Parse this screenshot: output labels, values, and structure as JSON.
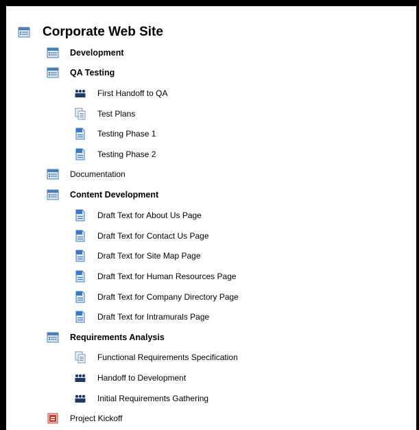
{
  "tree": {
    "root": {
      "label": "Corporate Web Site",
      "icon": "summary-task-icon"
    },
    "items": [
      {
        "label": "Development",
        "icon": "summary-task-icon",
        "bold": true
      },
      {
        "label": "QA Testing",
        "icon": "summary-task-icon",
        "bold": true
      },
      {
        "label": "First Handoff to QA",
        "icon": "team-milestone-icon"
      },
      {
        "label": "Test Plans",
        "icon": "document-copy-icon"
      },
      {
        "label": "Testing Phase 1",
        "icon": "task-icon"
      },
      {
        "label": "Testing Phase 2",
        "icon": "task-icon"
      },
      {
        "label": "Documentation",
        "icon": "summary-task-icon",
        "bold": false
      },
      {
        "label": "Content Development",
        "icon": "summary-task-icon",
        "bold": true
      },
      {
        "label": "Draft Text for About Us Page",
        "icon": "task-icon"
      },
      {
        "label": "Draft Text for Contact Us Page",
        "icon": "task-icon"
      },
      {
        "label": "Draft Text for Site Map Page",
        "icon": "task-icon"
      },
      {
        "label": "Draft Text for Human Resources Page",
        "icon": "task-icon"
      },
      {
        "label": "Draft Text for Company Directory Page",
        "icon": "task-icon"
      },
      {
        "label": "Draft Text for Intramurals Page",
        "icon": "task-icon"
      },
      {
        "label": "Requirements Analysis",
        "icon": "summary-task-icon",
        "bold": true
      },
      {
        "label": "Functional Requirements Specification",
        "icon": "document-copy-icon"
      },
      {
        "label": "Handoff to Development",
        "icon": "team-milestone-icon"
      },
      {
        "label": "Initial Requirements Gathering",
        "icon": "team-milestone-icon"
      },
      {
        "label": "Project Kickoff",
        "icon": "kickoff-icon"
      }
    ]
  },
  "colors": {
    "frame_border": "#000000",
    "summary_icon_blue": "#4a7fb5",
    "task_icon_blue": "#3a78c8",
    "team_icon_navy": "#1f3a6b",
    "kickoff_icon_red": "#c0392b"
  }
}
